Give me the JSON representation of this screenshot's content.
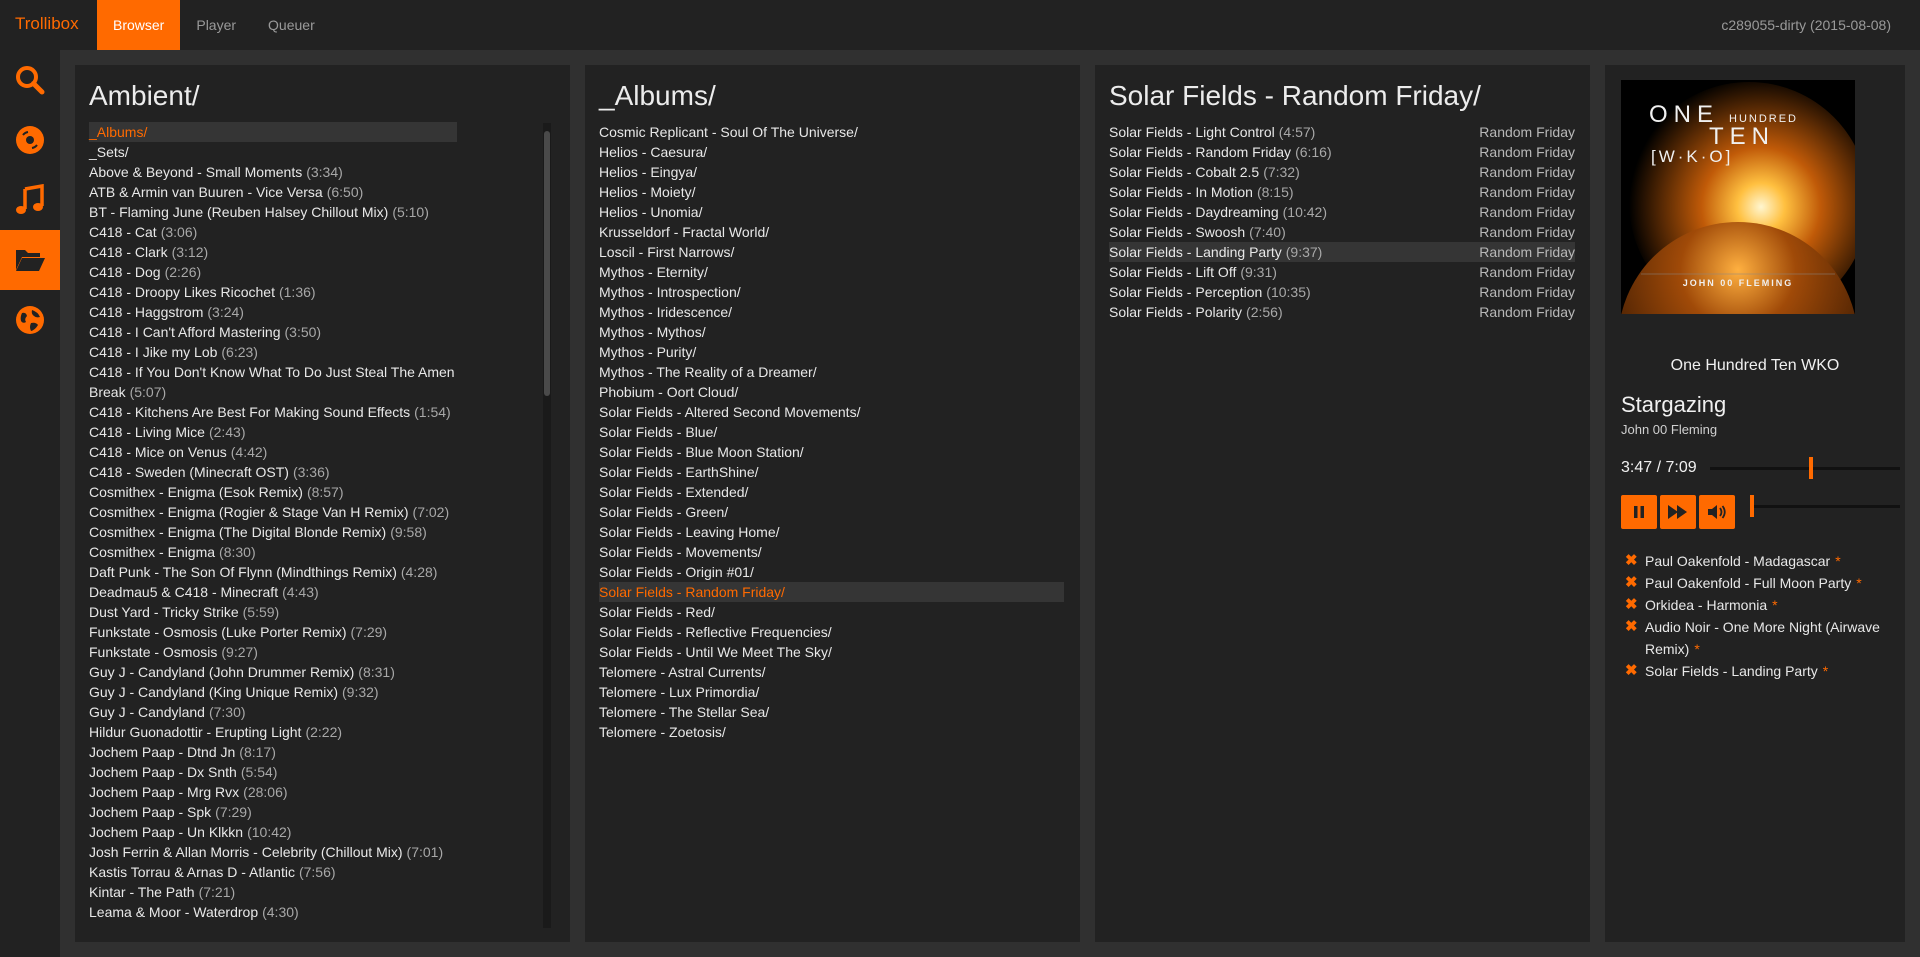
{
  "topbar": {
    "brand": "Trollibox",
    "tabs": [
      {
        "label": "Browser"
      },
      {
        "label": "Player"
      },
      {
        "label": "Queuer"
      }
    ],
    "version": "c289055-dirty (2015-08-08)"
  },
  "sidebar": {
    "items": [
      "search-icon",
      "disc-icon",
      "music-note-icon",
      "folder-open-icon",
      "globe-icon"
    ],
    "active": "folder-open-icon"
  },
  "colors": {
    "accent": "#ff6a00",
    "panel": "#222222",
    "background": "#303030"
  },
  "panel1": {
    "title": "Ambient/",
    "entries": [
      {
        "name": "_Albums/",
        "duration": ""
      },
      {
        "name": "_Sets/",
        "duration": ""
      },
      {
        "name": "Above & Beyond - Small Moments",
        "duration": "(3:34)"
      },
      {
        "name": "ATB & Armin van Buuren - Vice Versa",
        "duration": "(6:50)"
      },
      {
        "name": "BT - Flaming June (Reuben Halsey Chillout Mix)",
        "duration": "(5:10)"
      },
      {
        "name": "C418 - Cat",
        "duration": "(3:06)"
      },
      {
        "name": "C418 - Clark",
        "duration": "(3:12)"
      },
      {
        "name": "C418 - Dog",
        "duration": "(2:26)"
      },
      {
        "name": "C418 - Droopy Likes Ricochet",
        "duration": "(1:36)"
      },
      {
        "name": "C418 - Haggstrom",
        "duration": "(3:24)"
      },
      {
        "name": "C418 - I Can't Afford Mastering",
        "duration": "(3:50)"
      },
      {
        "name": "C418 - I Jike my Lob",
        "duration": "(6:23)"
      },
      {
        "name": "C418 - If You Don't Know What To Do Just Steal The Amen Break",
        "duration": "(5:07)"
      },
      {
        "name": "C418 - Kitchens Are Best For Making Sound Effects",
        "duration": "(1:54)"
      },
      {
        "name": "C418 - Living Mice",
        "duration": "(2:43)"
      },
      {
        "name": "C418 - Mice on Venus",
        "duration": "(4:42)"
      },
      {
        "name": "C418 - Sweden (Minecraft OST)",
        "duration": "(3:36)"
      },
      {
        "name": "Cosmithex - Enigma (Esok Remix)",
        "duration": "(8:57)"
      },
      {
        "name": "Cosmithex - Enigma (Rogier & Stage Van H Remix)",
        "duration": "(7:02)"
      },
      {
        "name": "Cosmithex - Enigma (The Digital Blonde Remix)",
        "duration": "(9:58)"
      },
      {
        "name": "Cosmithex - Enigma",
        "duration": "(8:30)"
      },
      {
        "name": "Daft Punk - The Son Of Flynn (Mindthings Remix)",
        "duration": "(4:28)"
      },
      {
        "name": "Deadmau5 & C418 - Minecraft",
        "duration": "(4:43)"
      },
      {
        "name": "Dust Yard - Tricky Strike",
        "duration": "(5:59)"
      },
      {
        "name": "Funkstate - Osmosis (Luke Porter Remix)",
        "duration": "(7:29)"
      },
      {
        "name": "Funkstate - Osmosis",
        "duration": "(9:27)"
      },
      {
        "name": "Guy J - Candyland (John Drummer Remix)",
        "duration": "(8:31)"
      },
      {
        "name": "Guy J - Candyland (King Unique Remix)",
        "duration": "(9:32)"
      },
      {
        "name": "Guy J - Candyland",
        "duration": "(7:30)"
      },
      {
        "name": "Hildur Guonadottir - Erupting Light",
        "duration": "(2:22)"
      },
      {
        "name": "Jochem Paap - Dtnd Jn",
        "duration": "(8:17)"
      },
      {
        "name": "Jochem Paap - Dx Snth",
        "duration": "(5:54)"
      },
      {
        "name": "Jochem Paap - Mrg Rvx",
        "duration": "(28:06)"
      },
      {
        "name": "Jochem Paap - Spk",
        "duration": "(7:29)"
      },
      {
        "name": "Jochem Paap - Un Klkkn",
        "duration": "(10:42)"
      },
      {
        "name": "Josh Ferrin & Allan Morris - Celebrity (Chillout Mix)",
        "duration": "(7:01)"
      },
      {
        "name": "Kastis Torrau & Arnas D - Atlantic",
        "duration": "(7:56)"
      },
      {
        "name": "Kintar - The Path",
        "duration": "(7:21)"
      },
      {
        "name": "Leama & Moor - Waterdrop",
        "duration": "(4:30)"
      }
    ],
    "selected_index": 0
  },
  "panel2": {
    "title": "_Albums/",
    "entries": [
      "Cosmic Replicant - Soul Of The Universe/",
      "Helios - Caesura/",
      "Helios - Eingya/",
      "Helios - Moiety/",
      "Helios - Unomia/",
      "Krusseldorf - Fractal World/",
      "Loscil - First Narrows/",
      "Mythos - Eternity/",
      "Mythos - Introspection/",
      "Mythos - Iridescence/",
      "Mythos - Mythos/",
      "Mythos - Purity/",
      "Mythos - The Reality of a Dreamer/",
      "Phobium - Oort Cloud/",
      "Solar Fields - Altered Second Movements/",
      "Solar Fields - Blue/",
      "Solar Fields - Blue Moon Station/",
      "Solar Fields - EarthShine/",
      "Solar Fields - Extended/",
      "Solar Fields - Green/",
      "Solar Fields - Leaving Home/",
      "Solar Fields - Movements/",
      "Solar Fields - Origin #01/",
      "Solar Fields - Random Friday/",
      "Solar Fields - Red/",
      "Solar Fields - Reflective Frequencies/",
      "Solar Fields - Until We Meet The Sky/",
      "Telomere - Astral Currents/",
      "Telomere - Lux Primordia/",
      "Telomere - The Stellar Sea/",
      "Telomere - Zoetosis/"
    ],
    "selected_index": 23
  },
  "panel3": {
    "title": "Solar Fields - Random Friday/",
    "tracks": [
      {
        "name": "Solar Fields - Light Control",
        "duration": "(4:57)",
        "album": "Random Friday"
      },
      {
        "name": "Solar Fields - Random Friday",
        "duration": "(6:16)",
        "album": "Random Friday"
      },
      {
        "name": "Solar Fields - Cobalt 2.5",
        "duration": "(7:32)",
        "album": "Random Friday"
      },
      {
        "name": "Solar Fields - In Motion",
        "duration": "(8:15)",
        "album": "Random Friday"
      },
      {
        "name": "Solar Fields - Daydreaming",
        "duration": "(10:42)",
        "album": "Random Friday"
      },
      {
        "name": "Solar Fields - Swoosh",
        "duration": "(7:40)",
        "album": "Random Friday"
      },
      {
        "name": "Solar Fields - Landing Party",
        "duration": "(9:37)",
        "album": "Random Friday"
      },
      {
        "name": "Solar Fields - Lift Off",
        "duration": "(9:31)",
        "album": "Random Friday"
      },
      {
        "name": "Solar Fields - Perception",
        "duration": "(10:35)",
        "album": "Random Friday"
      },
      {
        "name": "Solar Fields - Polarity",
        "duration": "(2:56)",
        "album": "Random Friday"
      }
    ],
    "hovered_index": 6
  },
  "player": {
    "cover_text": {
      "one": "ONE",
      "hundred": "HUNDRED",
      "ten": "TEN",
      "wko": "[W·K·O]",
      "artist": "JOHN 00 FLEMING"
    },
    "album": "One Hundred Ten WKO",
    "title": "Stargazing",
    "artist": "John 00 Fleming",
    "time": "3:47 / 7:09",
    "progress": 0.53,
    "volume": 0.0,
    "buttons": [
      "pause-icon",
      "skip-icon",
      "volume-icon"
    ]
  },
  "queue": {
    "items": [
      {
        "text": "Paul Oakenfold - Madagascar",
        "mark": "*"
      },
      {
        "text": "Paul Oakenfold - Full Moon Party",
        "mark": "*"
      },
      {
        "text": "Orkidea - Harmonia",
        "mark": "*"
      },
      {
        "text": "Audio Noir - One More Night (Airwave Remix)",
        "mark": "*"
      },
      {
        "text": "Solar Fields - Landing Party",
        "mark": "*"
      }
    ]
  }
}
